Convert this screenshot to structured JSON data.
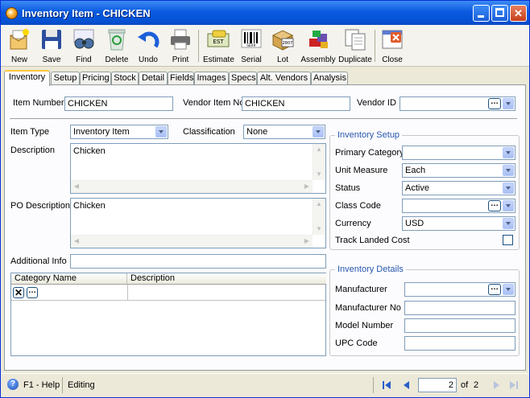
{
  "window": {
    "title": "Inventory Item - CHICKEN"
  },
  "toolbar": {
    "new": "New",
    "save": "Save",
    "find": "Find",
    "delete": "Delete",
    "undo": "Undo",
    "print": "Print",
    "estimate": "Estimate",
    "serial": "Serial",
    "lot": "Lot",
    "assembly": "Assembly",
    "duplicate": "Duplicate",
    "close": "Close",
    "estimate_icon_text": "EST",
    "serial_icon_text": "SER#",
    "lot_icon_text": "2807"
  },
  "tabs": [
    "Inventory",
    "Setup",
    "Pricing",
    "Stock",
    "Detail",
    "Fields",
    "Images",
    "Specs",
    "Alt. Vendors",
    "Analysis"
  ],
  "form": {
    "item_number_label": "Item Number",
    "item_number": "CHICKEN",
    "vendor_item_no_label": "Vendor Item No",
    "vendor_item_no": "CHICKEN",
    "vendor_id_label": "Vendor ID",
    "vendor_id": "",
    "item_type_label": "Item Type",
    "item_type": "Inventory Item",
    "classification_label": "Classification",
    "classification": "None",
    "description_label": "Description",
    "description": "Chicken",
    "po_description_label": "PO Description",
    "po_description": "Chicken",
    "additional_info_label": "Additional Info",
    "additional_info": ""
  },
  "category_grid": {
    "col1": "Category Name",
    "col2": "Description"
  },
  "inventory_setup": {
    "title": "Inventory Setup",
    "primary_category_label": "Primary Category",
    "primary_category": "",
    "unit_measure_label": "Unit Measure",
    "unit_measure": "Each",
    "status_label": "Status",
    "status": "Active",
    "class_code_label": "Class Code",
    "class_code": "",
    "currency_label": "Currency",
    "currency": "USD",
    "track_landed_cost_label": "Track Landed Cost"
  },
  "inventory_details": {
    "title": "Inventory Details",
    "manufacturer_label": "Manufacturer",
    "manufacturer": "",
    "manufacturer_no_label": "Manufacturer No",
    "manufacturer_no": "",
    "model_number_label": "Model Number",
    "model_number": "",
    "upc_code_label": "UPC Code",
    "upc_code": ""
  },
  "statusbar": {
    "help": "F1 - Help",
    "status": "Editing",
    "page": "2",
    "of_label": "of",
    "total": "2"
  }
}
